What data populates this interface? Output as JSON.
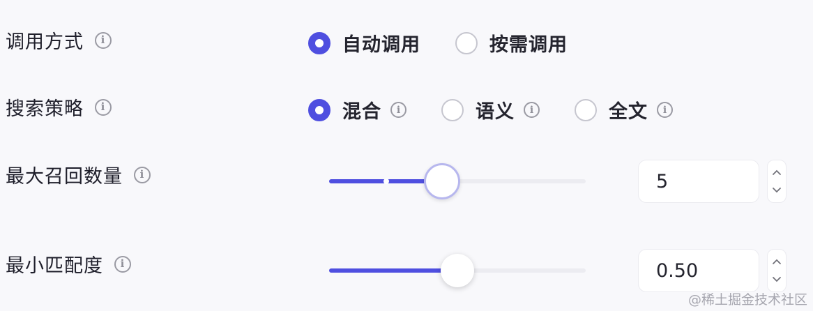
{
  "colors": {
    "accent": "#4f4fe0",
    "background": "#f8f8fb",
    "track": "#ececf1",
    "info_icon": "#9a9aa3"
  },
  "icons": {
    "info": "i"
  },
  "invocation": {
    "label": "调用方式",
    "options": [
      {
        "label": "自动调用",
        "checked": true
      },
      {
        "label": "按需调用",
        "checked": false
      }
    ]
  },
  "search_strategy": {
    "label": "搜索策略",
    "options": [
      {
        "label": "混合",
        "checked": true
      },
      {
        "label": "语义",
        "checked": false
      },
      {
        "label": "全文",
        "checked": false
      }
    ]
  },
  "max_recall": {
    "label": "最大召回数量",
    "value": "5",
    "slider_fraction": 0.44
  },
  "min_match": {
    "label": "最小匹配度",
    "value": "0.50",
    "slider_fraction": 0.5
  },
  "watermark": "@稀土掘金技术社区"
}
